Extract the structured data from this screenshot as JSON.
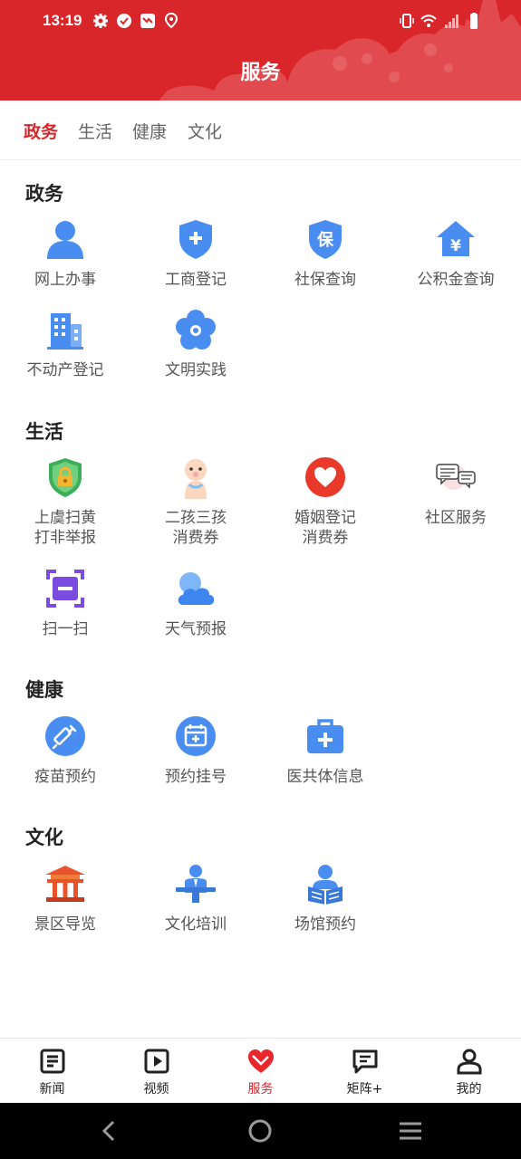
{
  "status_bar": {
    "time": "13:19"
  },
  "header": {
    "title": "服务"
  },
  "tabs": [
    {
      "label": "政务",
      "active": true
    },
    {
      "label": "生活",
      "active": false
    },
    {
      "label": "健康",
      "active": false
    },
    {
      "label": "文化",
      "active": false
    }
  ],
  "sections": {
    "gov": {
      "title": "政务",
      "items": [
        {
          "label": "网上办事",
          "icon": "person-icon"
        },
        {
          "label": "工商登记",
          "icon": "shield-plus-icon"
        },
        {
          "label": "社保查询",
          "icon": "shield-bao-icon"
        },
        {
          "label": "公积金查询",
          "icon": "house-yen-icon"
        },
        {
          "label": "不动产登记",
          "icon": "buildings-icon"
        },
        {
          "label": "文明实践",
          "icon": "flower-icon"
        }
      ]
    },
    "life": {
      "title": "生活",
      "items": [
        {
          "label": "上虞扫黄\n打非举报",
          "icon": "lock-shield-icon"
        },
        {
          "label": "二孩三孩\n消费券",
          "icon": "baby-icon"
        },
        {
          "label": "婚姻登记\n消费券",
          "icon": "heart-icon"
        },
        {
          "label": "社区服务",
          "icon": "chat-bubbles-icon"
        },
        {
          "label": "扫一扫",
          "icon": "scan-icon"
        },
        {
          "label": "天气预报",
          "icon": "weather-cloud-icon"
        }
      ]
    },
    "health": {
      "title": "健康",
      "items": [
        {
          "label": "疫苗预约",
          "icon": "syringe-icon"
        },
        {
          "label": "预约挂号",
          "icon": "calendar-plus-icon"
        },
        {
          "label": "医共体信息",
          "icon": "medical-kit-icon"
        }
      ]
    },
    "culture": {
      "title": "文化",
      "items": [
        {
          "label": "景区导览",
          "icon": "pavilion-icon"
        },
        {
          "label": "文化培训",
          "icon": "lecturer-icon"
        },
        {
          "label": "场馆预约",
          "icon": "reader-icon"
        }
      ]
    }
  },
  "bottom_nav": [
    {
      "label": "新闻",
      "icon": "news-icon"
    },
    {
      "label": "视频",
      "icon": "video-icon"
    },
    {
      "label": "服务",
      "icon": "service-heart-icon",
      "active": true
    },
    {
      "label": "矩阵+",
      "icon": "chat-box-icon"
    },
    {
      "label": "我的",
      "icon": "profile-icon"
    }
  ],
  "colors": {
    "brand": "#d8262b",
    "icon_blue": "#4a8df0"
  }
}
